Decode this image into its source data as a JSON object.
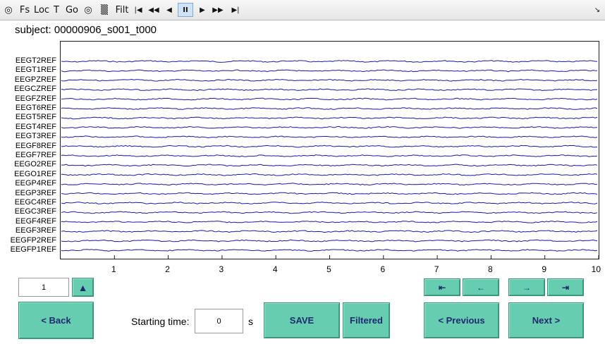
{
  "toolbar": {
    "items": [
      {
        "name": "globe-icon",
        "glyph": "◎"
      },
      {
        "name": "fs-button",
        "glyph": "Fs"
      },
      {
        "name": "loc-button",
        "glyph": "Loc"
      },
      {
        "name": "t-button",
        "glyph": "T"
      },
      {
        "name": "go-button",
        "glyph": "Go"
      },
      {
        "name": "montage-icon",
        "glyph": "◎"
      },
      {
        "name": "waveform-icon",
        "glyph": "▒"
      },
      {
        "name": "filt-button",
        "glyph": "Filt"
      },
      {
        "name": "skip-start-icon",
        "glyph": "|◀"
      },
      {
        "name": "rewind-icon",
        "glyph": "◀◀"
      },
      {
        "name": "step-back-icon",
        "glyph": "◀"
      },
      {
        "name": "pause-icon",
        "glyph": "II"
      },
      {
        "name": "play-icon",
        "glyph": "▶"
      },
      {
        "name": "fast-forward-icon",
        "glyph": "▶▶"
      },
      {
        "name": "skip-end-icon",
        "glyph": "▶|"
      }
    ],
    "collapse_glyph": "↘"
  },
  "subject": "subject: 00000906_s001_t000",
  "channels": [
    "EEGT2REF",
    "EEGT1REF",
    "EEGPZREF",
    "EEGCZREF",
    "EEGFZREF",
    "EEGT6REF",
    "EEGT5REF",
    "EEGT4REF",
    "EEGT3REF",
    "EEGF8REF",
    "EEGF7REF",
    "EEGO2REF",
    "EEGO1REF",
    "EEGP4REF",
    "EEGP3REF",
    "EEGC4REF",
    "EEGC3REF",
    "EEGF4REF",
    "EEGF3REF",
    "EEGFP2REF",
    "EEGFP1REF"
  ],
  "x_ticks": [
    "1",
    "2",
    "3",
    "4",
    "5",
    "6",
    "7",
    "8",
    "9",
    "10"
  ],
  "trace_color": "#1a1aa8",
  "page_input": "1",
  "up_arrow": "▲",
  "buttons": {
    "back": "<  Back",
    "save": "SAVE",
    "filtered": "Filtered",
    "previous": "< Previous",
    "next": "Next  >",
    "skip_back": "⇤",
    "back_arrow": "←",
    "forward_arrow": "→",
    "skip_forward": "⇥"
  },
  "starting_time_label": "Starting time:",
  "starting_time_value": "0",
  "starting_time_unit": "s"
}
